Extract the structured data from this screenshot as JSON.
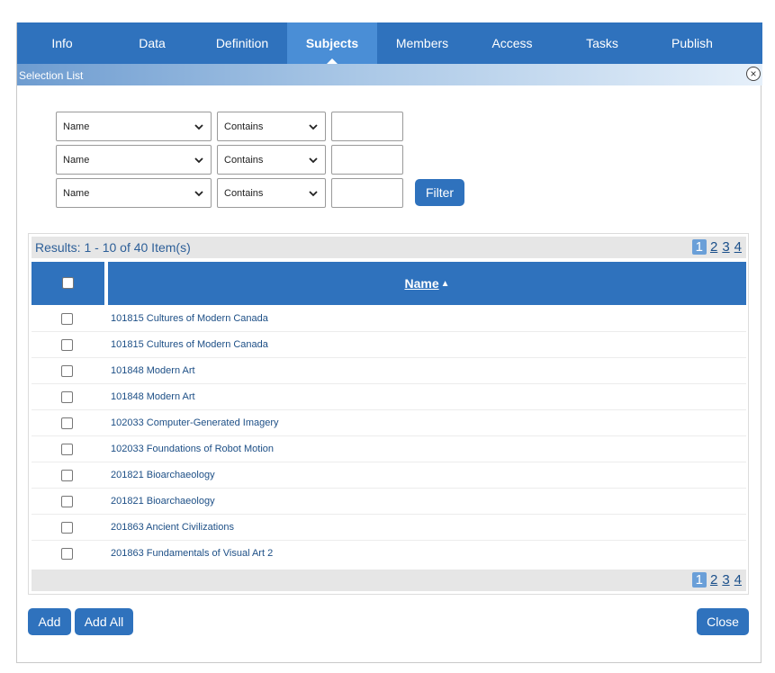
{
  "tabs": [
    {
      "label": "Info"
    },
    {
      "label": "Data"
    },
    {
      "label": "Definition"
    },
    {
      "label": "Subjects",
      "active": true
    },
    {
      "label": "Members"
    },
    {
      "label": "Access"
    },
    {
      "label": "Tasks"
    },
    {
      "label": "Publish"
    }
  ],
  "selection_list": {
    "title": "Selection List",
    "close_icon": "×"
  },
  "filters": [
    {
      "field": "Name",
      "operator": "Contains",
      "value": ""
    },
    {
      "field": "Name",
      "operator": "Contains",
      "value": ""
    },
    {
      "field": "Name",
      "operator": "Contains",
      "value": ""
    }
  ],
  "filter_button": "Filter",
  "results": {
    "summary": "Results: 1 - 10 of 40 Item(s)",
    "pages": [
      "1",
      "2",
      "3",
      "4"
    ],
    "current_page": "1",
    "column_name": "Name",
    "sort_icon": "▲",
    "rows": [
      "101815 Cultures of Modern Canada",
      "101815 Cultures of Modern Canada",
      "101848 Modern Art",
      "101848 Modern Art",
      "102033 Computer-Generated Imagery",
      "102033 Foundations of Robot Motion",
      "201821 Bioarchaeology",
      "201821 Bioarchaeology",
      "201863 Ancient Civilizations",
      "201863 Fundamentals of Visual Art 2"
    ]
  },
  "buttons": {
    "add": "Add",
    "add_all": "Add All",
    "close": "Close"
  },
  "colors": {
    "tab_bar": "#2f72bd",
    "tab_active": "#4a8ed6",
    "button": "#2f72bd",
    "link": "#1d4f86"
  }
}
